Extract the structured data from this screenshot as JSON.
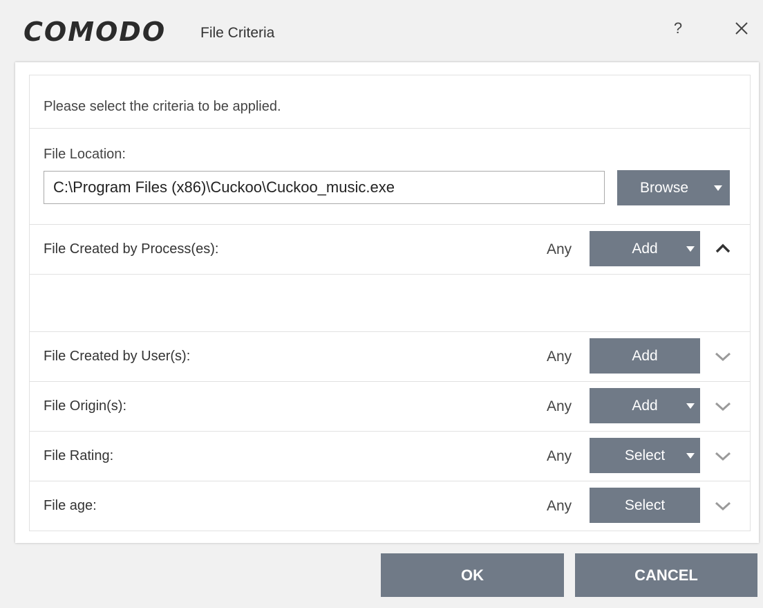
{
  "window": {
    "brand": "COMODO",
    "title": "File Criteria",
    "help_label": "?"
  },
  "intro_text": "Please select the criteria to be applied.",
  "file_location": {
    "label": "File Location:",
    "value": "C:\\Program Files (x86)\\Cuckoo\\Cuckoo_music.exe",
    "browse_label": "Browse"
  },
  "sections": [
    {
      "label": "File Created by Process(es):",
      "value": "Any",
      "button": "Add",
      "has_dropdown": true,
      "expanded": true
    },
    {
      "label": "File Created by User(s):",
      "value": "Any",
      "button": "Add",
      "has_dropdown": false,
      "expanded": false
    },
    {
      "label": "File Origin(s):",
      "value": "Any",
      "button": "Add",
      "has_dropdown": true,
      "expanded": false
    },
    {
      "label": "File Rating:",
      "value": "Any",
      "button": "Select",
      "has_dropdown": true,
      "expanded": false
    },
    {
      "label": "File age:",
      "value": "Any",
      "button": "Select",
      "has_dropdown": false,
      "expanded": false
    }
  ],
  "footer": {
    "ok_label": "OK",
    "cancel_label": "CANCEL"
  },
  "colors": {
    "button_bg": "#707a87",
    "window_bg": "#f1f1f1",
    "panel_bg": "#ffffff"
  }
}
